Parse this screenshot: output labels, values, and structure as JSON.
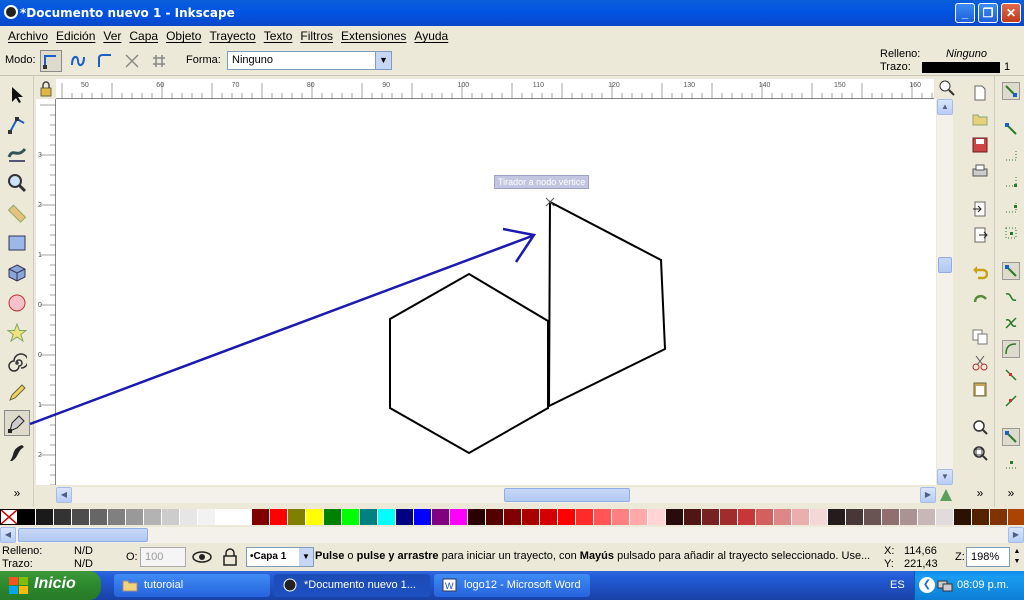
{
  "window": {
    "title": "*Documento nuevo 1 - Inkscape"
  },
  "menu": [
    "Archivo",
    "Edición",
    "Ver",
    "Capa",
    "Objeto",
    "Trayecto",
    "Texto",
    "Filtros",
    "Extensiones",
    "Ayuda"
  ],
  "toolctrl": {
    "mode_label": "Modo:",
    "forma_label": "Forma:",
    "forma_value": "Ninguno",
    "fill_label": "Relleno:",
    "fill_value": "Ninguno",
    "stroke_label": "Trazo:",
    "stroke_width": "1"
  },
  "ruler_h": [
    "50",
    "60",
    "70",
    "80",
    "90",
    "100",
    "110",
    "120",
    "130",
    "140",
    "150",
    "160"
  ],
  "ruler_v": [
    "3",
    "2",
    "1",
    "0",
    "0",
    "1",
    "2",
    "3"
  ],
  "canvas": {
    "tooltip": "Tirador a nodo vértice"
  },
  "statusbar": {
    "fill_label": "Relleno:",
    "fill_value": "N/D",
    "stroke_label": "Trazo:",
    "stroke_value": "N/D",
    "opacity_label": "O:",
    "opacity_value": "100",
    "layer": "•Capa 1",
    "msg_b1": "Pulse",
    "msg_t1": " o ",
    "msg_b2": "pulse y arrastre",
    "msg_t2": " para iniciar un trayecto, con ",
    "msg_b3": "Mayús",
    "msg_t3": " pulsado para añadir al trayecto seleccionado. Use...",
    "x_label": "X:",
    "x_value": "114,66",
    "y_label": "Y:",
    "y_value": "221,43",
    "zoom_label": "Z:",
    "zoom_value": "198%"
  },
  "palette": [
    "#000000",
    "#1a1a1a",
    "#333333",
    "#4d4d4d",
    "#666666",
    "#808080",
    "#999999",
    "#b3b3b3",
    "#cccccc",
    "#e6e6e6",
    "#f2f2f2",
    "#ffffff",
    "#ffffff",
    "#800000",
    "#ff0000",
    "#808000",
    "#ffff00",
    "#008000",
    "#00ff00",
    "#008080",
    "#00ffff",
    "#000080",
    "#0000ff",
    "#800080",
    "#ff00ff",
    "#2b0000",
    "#550000",
    "#800000",
    "#aa0000",
    "#d40000",
    "#ff0000",
    "#ff2a2a",
    "#ff5555",
    "#ff8080",
    "#ffaaaa",
    "#ffd5d5",
    "#280b0b",
    "#501616",
    "#782121",
    "#a02c2c",
    "#c83737",
    "#d35f5f",
    "#de8787",
    "#e9afaf",
    "#f4d7d7",
    "#241c1c",
    "#483737",
    "#6c5353",
    "#916f6f",
    "#ac9393",
    "#c8b7b7",
    "#e3dbdb",
    "#2b1100",
    "#552200",
    "#803300",
    "#aa4400",
    "#d45500"
  ],
  "taskbar": {
    "start": "Inicio",
    "tasks": [
      "tutoroial",
      "*Documento nuevo 1...",
      "logo12 - Microsoft Word"
    ],
    "lang": "ES",
    "time": "08:09 p.m."
  }
}
